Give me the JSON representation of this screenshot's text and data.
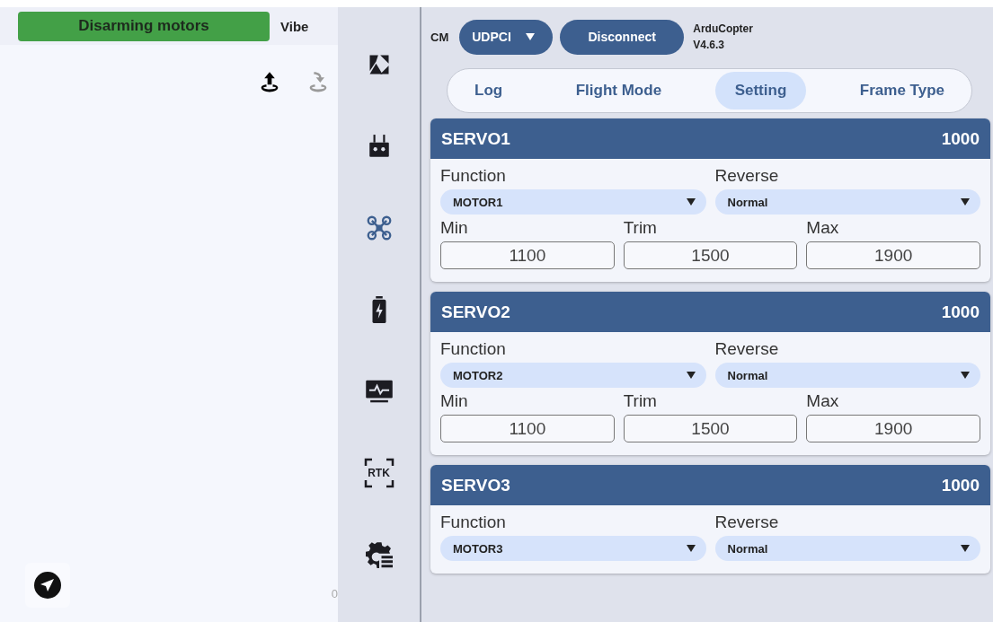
{
  "status": {
    "message": "Disarming motors",
    "tab": "Vibe"
  },
  "map": {
    "progress": "0"
  },
  "nav": [
    {
      "kind": "gallery",
      "selected": false
    },
    {
      "kind": "remote",
      "selected": false
    },
    {
      "kind": "drone",
      "selected": true
    },
    {
      "kind": "battery",
      "selected": false
    },
    {
      "kind": "monitor",
      "selected": false
    },
    {
      "kind": "rtk",
      "label": "RTK",
      "selected": false
    },
    {
      "kind": "settings",
      "selected": false
    }
  ],
  "connection": {
    "label": "CM",
    "link": "UDPCI",
    "action": "Disconnect",
    "firmware": "ArduCopter",
    "version": "V4.6.3"
  },
  "tabs": [
    {
      "label": "Log",
      "selected": false
    },
    {
      "label": "Flight Mode",
      "selected": false
    },
    {
      "label": "Setting",
      "selected": true
    },
    {
      "label": "Frame Type",
      "selected": false
    }
  ],
  "servos": [
    {
      "name": "SERVO1",
      "value": "1000",
      "fields": [
        {
          "kind": "select",
          "label": "Function",
          "value": "MOTOR1"
        },
        {
          "kind": "select",
          "label": "Reverse",
          "value": "Normal"
        },
        {
          "kind": "number",
          "label": "Min",
          "value": "1100"
        },
        {
          "kind": "number",
          "label": "Trim",
          "value": "1500"
        },
        {
          "kind": "number",
          "label": "Max",
          "value": "1900"
        }
      ]
    },
    {
      "name": "SERVO2",
      "value": "1000",
      "fields": [
        {
          "kind": "select",
          "label": "Function",
          "value": "MOTOR2"
        },
        {
          "kind": "select",
          "label": "Reverse",
          "value": "Normal"
        },
        {
          "kind": "number",
          "label": "Min",
          "value": "1100"
        },
        {
          "kind": "number",
          "label": "Trim",
          "value": "1500"
        },
        {
          "kind": "number",
          "label": "Max",
          "value": "1900"
        }
      ]
    },
    {
      "name": "SERVO3",
      "value": "1000",
      "fields": [
        {
          "kind": "select",
          "label": "Function",
          "value": "MOTOR3"
        },
        {
          "kind": "select",
          "label": "Reverse",
          "value": "Normal"
        }
      ]
    }
  ]
}
